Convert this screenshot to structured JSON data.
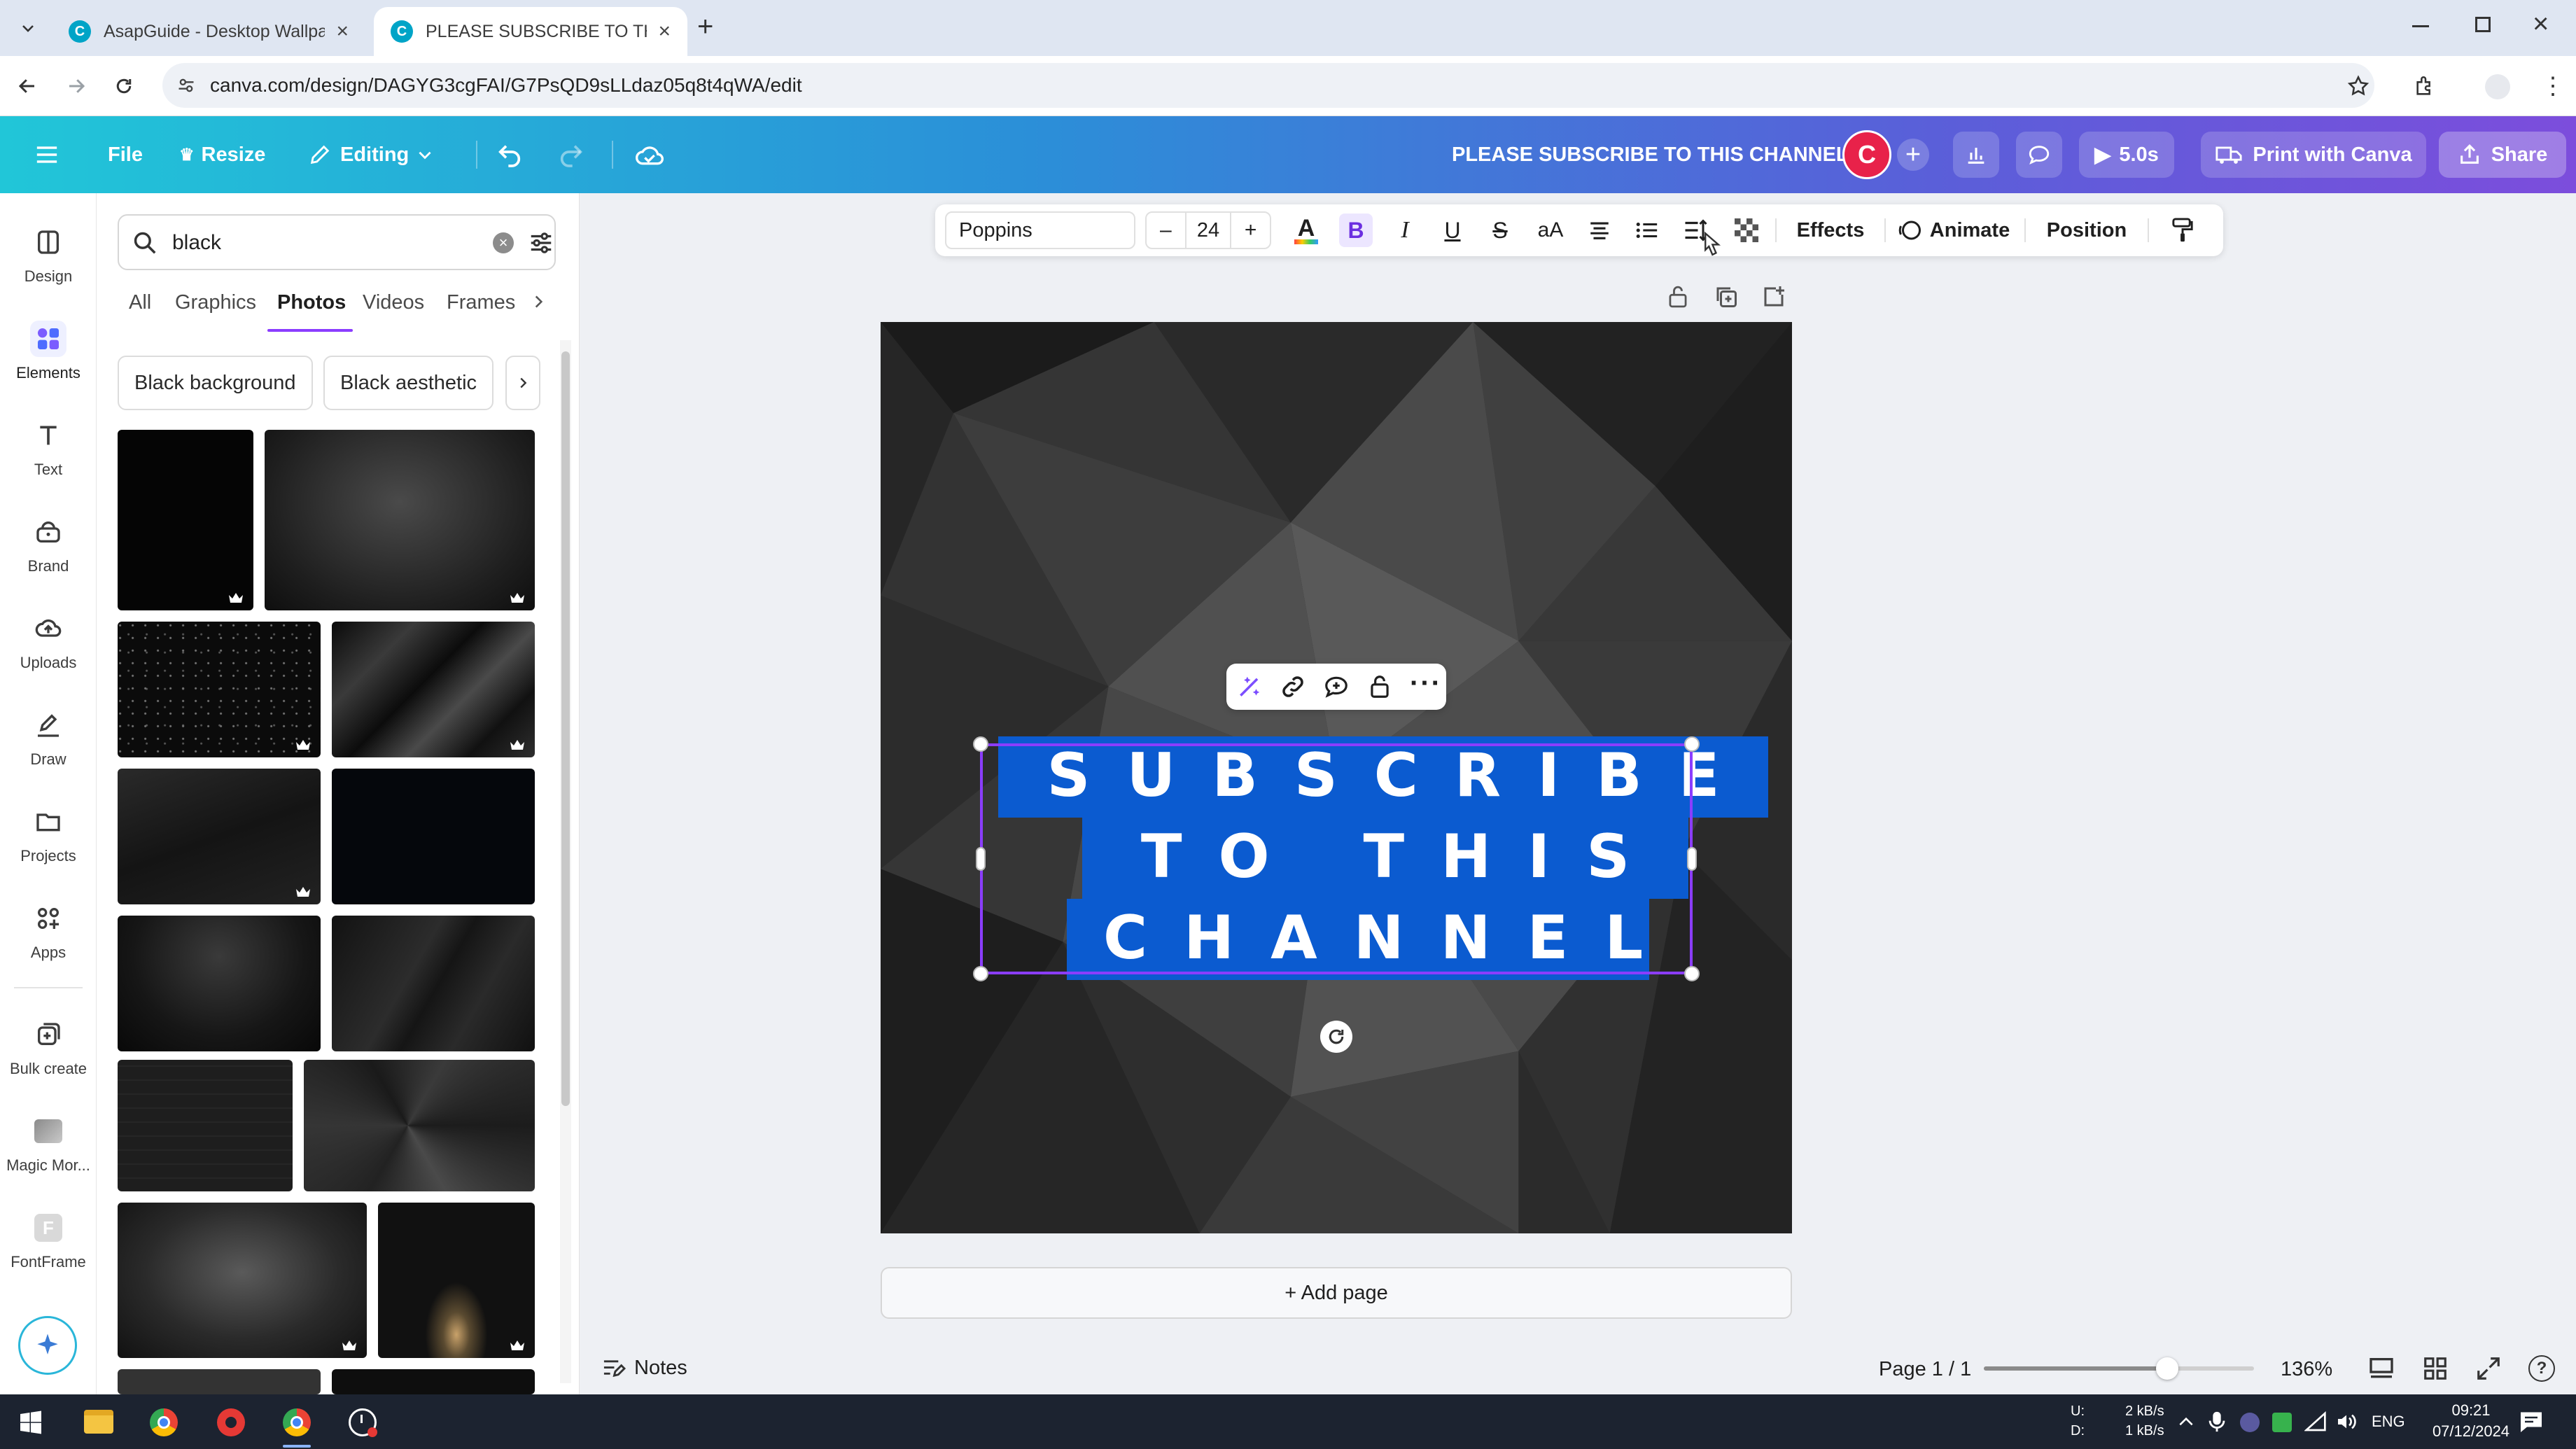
{
  "browser": {
    "tabs": [
      {
        "title": "AsapGuide - Desktop Wallpape",
        "favicon": "C"
      },
      {
        "title": "PLEASE SUBSCRIBE TO THIS CH",
        "favicon": "C"
      }
    ],
    "url": "canva.com/design/DAGYG3cgFAI/G7PsQD9sLLdaz05q8t4qWA/edit"
  },
  "header": {
    "file": "File",
    "resize": "Resize",
    "editing": "Editing",
    "doc_title": "PLEASE SUBSCRIBE TO THIS CHANNEL",
    "avatar_letter": "C",
    "play_duration": "5.0s",
    "print": "Print with Canva",
    "share": "Share"
  },
  "rail": {
    "items": [
      {
        "label": "Design",
        "icon": "design-icon"
      },
      {
        "label": "Elements",
        "icon": "elements-icon"
      },
      {
        "label": "Text",
        "icon": "text-icon"
      },
      {
        "label": "Brand",
        "icon": "brand-icon"
      },
      {
        "label": "Uploads",
        "icon": "uploads-icon"
      },
      {
        "label": "Draw",
        "icon": "draw-icon"
      },
      {
        "label": "Projects",
        "icon": "projects-icon"
      },
      {
        "label": "Apps",
        "icon": "apps-icon"
      },
      {
        "label": "Bulk create",
        "icon": "bulk-create-icon"
      },
      {
        "label": "Magic Mor...",
        "icon": "magic-morph-icon"
      },
      {
        "label": "FontFrame",
        "icon": "fontframe-icon"
      }
    ]
  },
  "panel": {
    "search_value": "black",
    "tabs": [
      "All",
      "Graphics",
      "Photos",
      "Videos",
      "Frames"
    ],
    "active_tab": "Photos",
    "chips": [
      "Black background",
      "Black aesthetic"
    ]
  },
  "toolbar": {
    "font": "Poppins",
    "minus": "–",
    "size": "24",
    "plus": "+",
    "bold": "B",
    "italic": "I",
    "underline": "U",
    "strike": "S",
    "case": "aA",
    "effects": "Effects",
    "animate": "Animate",
    "position": "Position"
  },
  "design": {
    "line1": "SUBSCRIBE",
    "line2": "TO THIS",
    "line3": "CHANNEL",
    "highlight_color": "#0b5bd0"
  },
  "canvas": {
    "add_page": "+ Add page"
  },
  "footer": {
    "notes": "Notes",
    "page": "Page 1 / 1",
    "zoom": "136%",
    "zoom_level_fraction": 0.68
  },
  "taskbar": {
    "net_up_label": "U:",
    "net_down_label": "D:",
    "net_up": "2 kB/s",
    "net_down": "1 kB/s",
    "lang": "ENG",
    "time": "09:21",
    "date": "07/12/2024"
  },
  "colors": {
    "accent": "#8b3dff",
    "avatar": "#e8224a"
  }
}
